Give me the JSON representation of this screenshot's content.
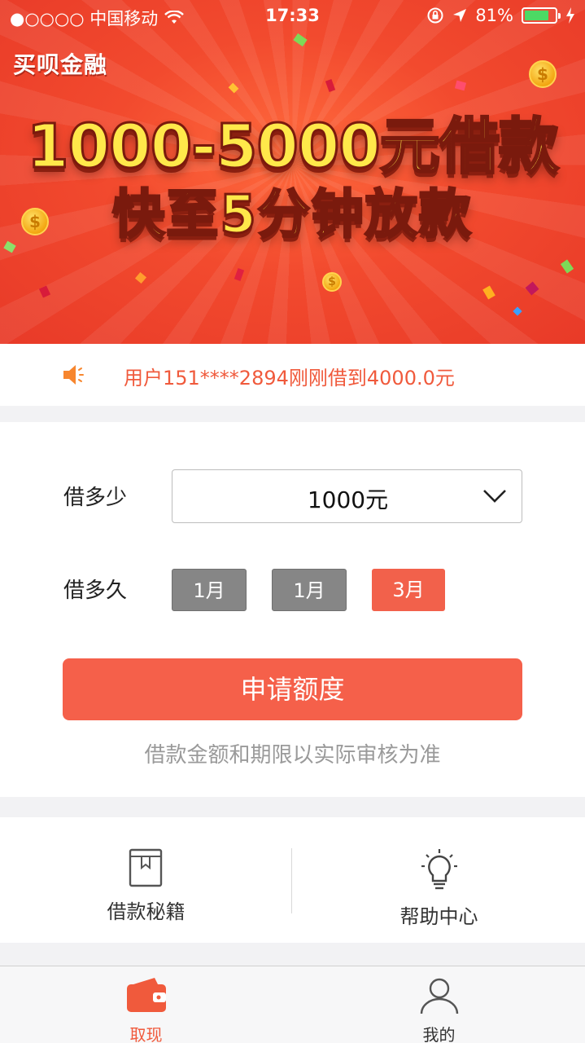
{
  "status_bar": {
    "carrier": "●○○○○ 中国移动",
    "time": "17:33",
    "battery": "81%"
  },
  "banner": {
    "brand": "买呗金融",
    "headline_line1": "1000-5000元借款",
    "headline_line2": "快至5分钟放款"
  },
  "ticker": {
    "message": "用户151****2894刚刚借到4000.0元"
  },
  "form": {
    "amount_label": "借多少",
    "amount_value": "1000元",
    "term_label": "借多久",
    "term_options": [
      "1月",
      "1月",
      "3月"
    ],
    "term_selected_index": 2,
    "apply_button": "申请额度",
    "note": "借款金额和期限以实际审核为准"
  },
  "links": {
    "tips_label": "借款秘籍",
    "help_label": "帮助中心"
  },
  "tabbar": {
    "tabs": [
      {
        "label": "取现",
        "icon": "wallet-icon",
        "active": true
      },
      {
        "label": "我的",
        "icon": "user-icon",
        "active": false
      }
    ],
    "active_color": "#f05a3c",
    "inactive_color": "#555555"
  },
  "colors": {
    "accent": "#f5604a",
    "banner_red": "#f24a2e",
    "ticker_text": "#f05a3c"
  }
}
